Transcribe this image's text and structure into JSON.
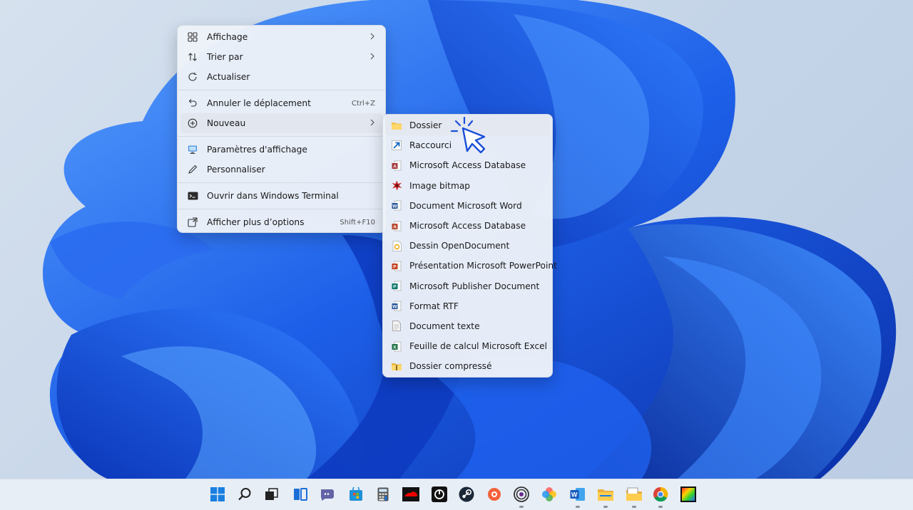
{
  "context_menu": {
    "items": [
      {
        "label": "Affichage",
        "icon": "grid-view-icon",
        "submenu": true
      },
      {
        "label": "Trier par",
        "icon": "sort-icon",
        "submenu": true
      },
      {
        "label": "Actualiser",
        "icon": "refresh-icon"
      },
      {
        "label": "Annuler le déplacement",
        "icon": "undo-icon",
        "shortcut": "Ctrl+Z"
      },
      {
        "label": "Nouveau",
        "icon": "new-plus-icon",
        "submenu": true
      },
      {
        "label": "Paramètres d'affichage",
        "icon": "display-settings-icon"
      },
      {
        "label": "Personnaliser",
        "icon": "personalize-pen-icon"
      },
      {
        "label": "Ouvrir dans Windows Terminal",
        "icon": "terminal-icon"
      },
      {
        "label": "Afficher plus d’options",
        "icon": "more-options-icon",
        "shortcut": "Shift+F10"
      }
    ]
  },
  "new_submenu": {
    "items": [
      {
        "label": "Dossier",
        "icon": "folder-icon"
      },
      {
        "label": "Raccourci",
        "icon": "shortcut-icon"
      },
      {
        "label": "Microsoft Access Database",
        "icon": "access-icon"
      },
      {
        "label": "Image bitmap",
        "icon": "bitmap-icon"
      },
      {
        "label": "Document Microsoft Word",
        "icon": "word-icon"
      },
      {
        "label": "Microsoft Access Database",
        "icon": "access-icon"
      },
      {
        "label": "Dessin OpenDocument",
        "icon": "opendocument-draw-icon"
      },
      {
        "label": "Présentation Microsoft PowerPoint",
        "icon": "powerpoint-icon"
      },
      {
        "label": "Microsoft Publisher Document",
        "icon": "publisher-icon"
      },
      {
        "label": "Format RTF",
        "icon": "rtf-icon"
      },
      {
        "label": "Document texte",
        "icon": "text-document-icon"
      },
      {
        "label": "Feuille de calcul Microsoft Excel",
        "icon": "excel-icon"
      },
      {
        "label": "Dossier compressé",
        "icon": "zip-folder-icon"
      }
    ]
  },
  "taskbar": {
    "icons": [
      "start-icon",
      "search-icon",
      "task-view-icon",
      "widgets-icon",
      "teams-chat-icon",
      "store-icon",
      "calculator-icon",
      "redhat-icon",
      "app-icon",
      "steam-icon",
      "app-orange-icon",
      "app-target-icon",
      "photos-icon",
      "word-icon",
      "file-explorer-icon",
      "folder-app-icon",
      "chrome-icon",
      "color-app-icon"
    ]
  },
  "colors": {
    "accent": "#0f6cbd",
    "wallpaper_blue": "#1a4fd8"
  }
}
